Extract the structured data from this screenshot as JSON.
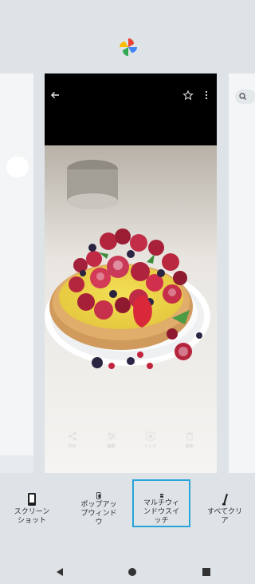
{
  "center_card": {
    "action_bar": [
      {
        "name": "share",
        "label": "共有"
      },
      {
        "name": "edit",
        "label": "編集"
      },
      {
        "name": "lens",
        "label": "レンズ"
      },
      {
        "name": "delete",
        "label": "削除"
      }
    ]
  },
  "options": [
    {
      "name": "screenshot",
      "label_lines": [
        "スクリーン",
        "ショット"
      ]
    },
    {
      "name": "popup-window",
      "label_lines": [
        "ポップアッ",
        "プウィンド",
        "ウ"
      ]
    },
    {
      "name": "multi-window",
      "label_lines": [
        "マルチウィ",
        "ンドウスイ",
        "ッチ"
      ],
      "selected": true
    },
    {
      "name": "clear-all",
      "label_lines": [
        "すべてクリ",
        "ア"
      ]
    }
  ],
  "colors": {
    "background": "#dde3e6",
    "selected_outline": "#29a3d9",
    "card_dark": "#000000"
  },
  "icons": {
    "app": "google-photos-icon",
    "nav": [
      "back-icon",
      "home-icon",
      "recents-icon"
    ]
  }
}
